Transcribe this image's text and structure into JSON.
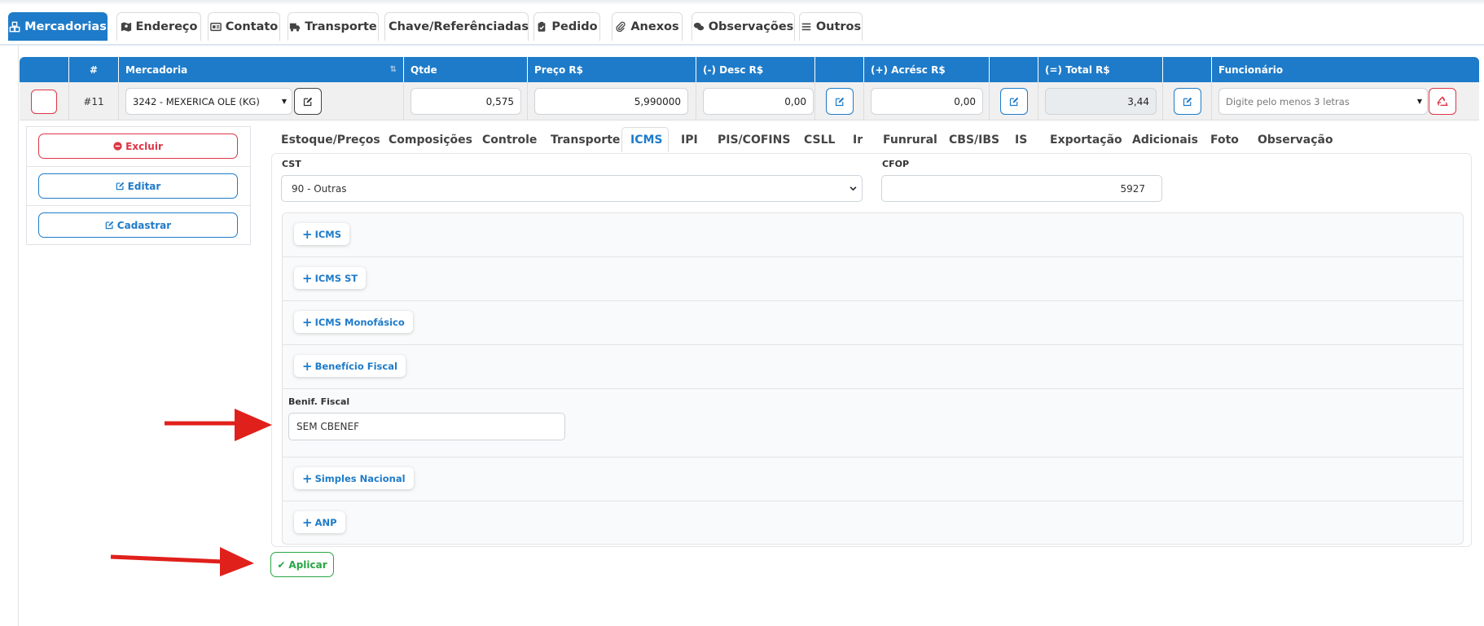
{
  "top_tabs": [
    {
      "label": "Mercadorias",
      "icon": "cubes-icon"
    },
    {
      "label": "Endereço",
      "icon": "map-icon"
    },
    {
      "label": "Contato",
      "icon": "id-card-icon"
    },
    {
      "label": "Transporte",
      "icon": "truck-icon"
    },
    {
      "label": "Chave/Referênciadas",
      "icon": "list-icon"
    },
    {
      "label": "Pedido",
      "icon": "clipboard-check-icon"
    },
    {
      "label": "Anexos",
      "icon": "paperclip-icon"
    },
    {
      "label": "Observações",
      "icon": "comments-icon"
    },
    {
      "label": "Outros",
      "icon": "list-icon"
    }
  ],
  "grid": {
    "headers": {
      "num": "#",
      "mercadoria": "Mercadoria",
      "qtde": "Qtde",
      "preco": "Preço R$",
      "desc": "(-) Desc R$",
      "acresc": "(+) Acrésc R$",
      "total": "(=) Total R$",
      "funcionario": "Funcionário"
    },
    "row": {
      "num": "#11",
      "mercadoria": "3242 - MEXERICA OLE (KG)",
      "qtde": "0,575",
      "preco": "5,990000",
      "desc": "0,00",
      "acresc": "0,00",
      "total": "3,44",
      "funcionario_placeholder": "Digite pelo menos 3 letras"
    }
  },
  "actions": {
    "excluir": "Excluir",
    "editar": "Editar",
    "cadastrar": "Cadastrar"
  },
  "sub_tabs": [
    "Estoque/Preços",
    "Composições",
    "Controle",
    "Transporte",
    "ICMS",
    "IPI",
    "PIS/COFINS",
    "CSLL",
    "Ir",
    "Funrural",
    "CBS/IBS",
    "IS",
    "Exportação",
    "Adicionais",
    "Foto",
    "Observação"
  ],
  "active_sub_tab": "ICMS",
  "icms": {
    "cst_label": "CST",
    "cst_value": "90 - Outras",
    "cfop_label": "CFOP",
    "cfop_value": "5927",
    "sections": [
      "ICMS",
      "ICMS ST",
      "ICMS Monofásico",
      "Benefício Fiscal",
      "Simples Nacional",
      "ANP"
    ],
    "benef_label": "Benif. Fiscal",
    "benef_value": "SEM CBENEF"
  },
  "apply_label": "Aplicar",
  "colors": {
    "primary": "#1e7bc9",
    "danger": "#dc3545",
    "success": "#28a745",
    "arrow": "#e0201b"
  }
}
